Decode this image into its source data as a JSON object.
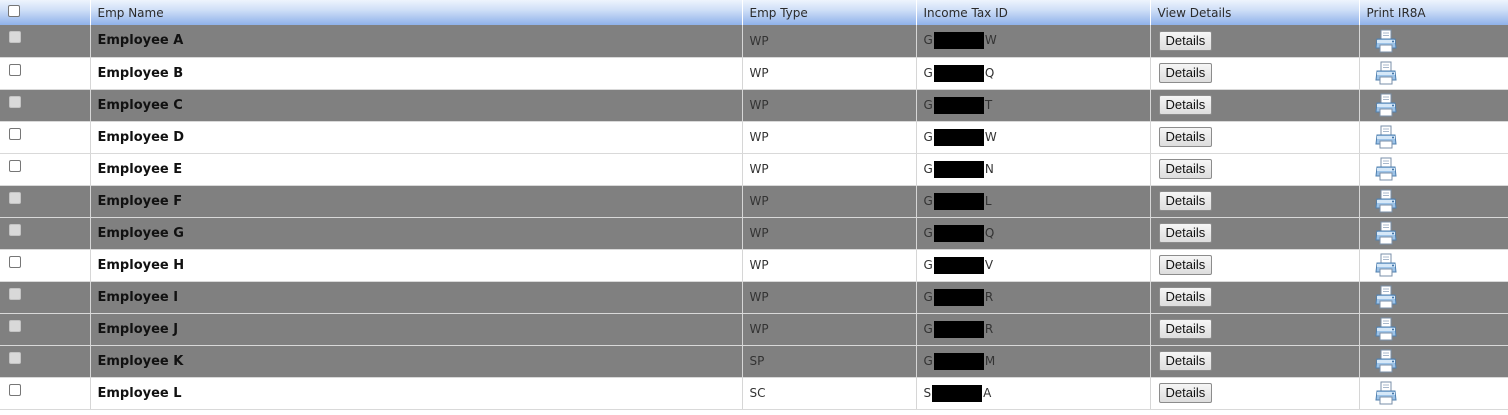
{
  "columns": {
    "name": "Emp Name",
    "type": "Emp Type",
    "tax": "Income Tax ID",
    "details": "View Details",
    "print": "Print IR8A"
  },
  "rows": [
    {
      "name": "Employee A",
      "type": "WP",
      "tax_first": "G",
      "tax_last": "W",
      "details_label": "Details",
      "disabled": true
    },
    {
      "name": "Employee B",
      "type": "WP",
      "tax_first": "G",
      "tax_last": "Q",
      "details_label": "Details",
      "disabled": false
    },
    {
      "name": "Employee C",
      "type": "WP",
      "tax_first": "G",
      "tax_last": "T",
      "details_label": "Details",
      "disabled": true
    },
    {
      "name": "Employee D",
      "type": "WP",
      "tax_first": "G",
      "tax_last": "W",
      "details_label": "Details",
      "disabled": false
    },
    {
      "name": "Employee E",
      "type": "WP",
      "tax_first": "G",
      "tax_last": "N",
      "details_label": "Details",
      "disabled": false
    },
    {
      "name": "Employee F",
      "type": "WP",
      "tax_first": "G",
      "tax_last": "L",
      "details_label": "Details",
      "disabled": true
    },
    {
      "name": "Employee G",
      "type": "WP",
      "tax_first": "G",
      "tax_last": "Q",
      "details_label": "Details",
      "disabled": true
    },
    {
      "name": "Employee H",
      "type": "WP",
      "tax_first": "G",
      "tax_last": "V",
      "details_label": "Details",
      "disabled": false
    },
    {
      "name": "Employee I",
      "type": "WP",
      "tax_first": "G",
      "tax_last": "R",
      "details_label": "Details",
      "disabled": true
    },
    {
      "name": "Employee J",
      "type": "WP",
      "tax_first": "G",
      "tax_last": "R",
      "details_label": "Details",
      "disabled": true
    },
    {
      "name": "Employee K",
      "type": "SP",
      "tax_first": "G",
      "tax_last": "M",
      "details_label": "Details",
      "disabled": true
    },
    {
      "name": "Employee L",
      "type": "SC",
      "tax_first": "S",
      "tax_last": "A",
      "details_label": "Details",
      "disabled": false
    }
  ],
  "colors": {
    "disabled_row": "#808080",
    "enabled_row": "#ffffff",
    "header_gradient_bottom": "#8fb1ea"
  },
  "icons": {
    "print": "printer-icon",
    "checkbox": "checkbox"
  }
}
